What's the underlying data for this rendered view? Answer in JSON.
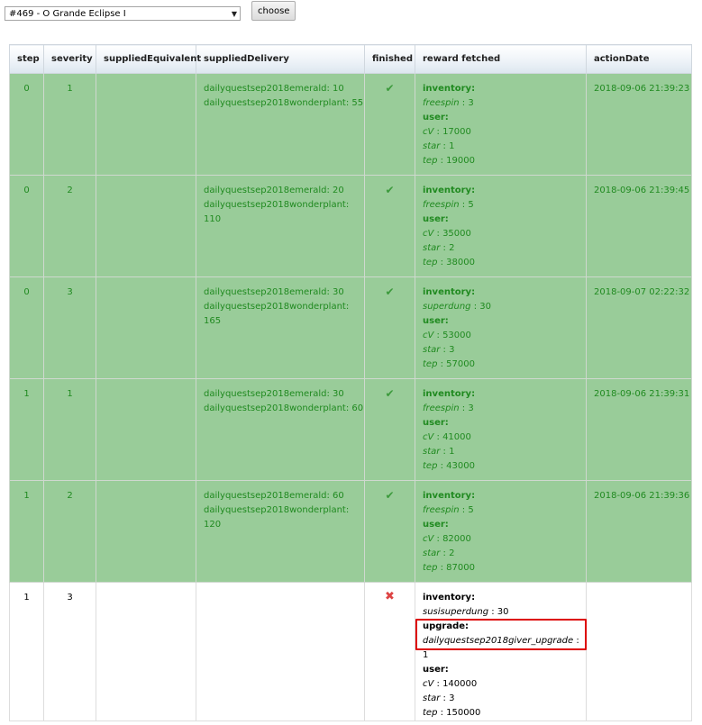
{
  "selector": {
    "selected_value": "#469 - O Grande Eclipse I",
    "arrow_icon": "dropdown-arrow-icon"
  },
  "choose_button": {
    "label": "choose"
  },
  "table": {
    "headers": [
      "step",
      "severity",
      "suppliedEquivalent",
      "suppliedDelivery",
      "finished",
      "reward fetched",
      "actionDate"
    ],
    "rows": [
      {
        "step": "0",
        "severity": "1",
        "supplied_equivalent": "",
        "delivery": [
          "dailyquestsep2018emerald: 10",
          "dailyquestsep2018wonderplant: 55"
        ],
        "finished_icon": "check-icon",
        "finished_glyph": "✔",
        "reward": [
          {
            "text": "inventory:",
            "style": "key"
          },
          {
            "text": "freespin",
            "value": " : 3",
            "style": "sub"
          },
          {
            "text": "user:",
            "style": "key"
          },
          {
            "text": "cV",
            "value": " : 17000",
            "style": "sub"
          },
          {
            "text": "star",
            "value": " : 1",
            "style": "sub"
          },
          {
            "text": "tep",
            "value": " : 19000",
            "style": "sub"
          }
        ],
        "date": "2018-09-06 21:39:23"
      },
      {
        "step": "0",
        "severity": "2",
        "supplied_equivalent": "",
        "delivery": [
          "dailyquestsep2018emerald: 20",
          "dailyquestsep2018wonderplant: 110"
        ],
        "finished_icon": "check-icon",
        "finished_glyph": "✔",
        "reward": [
          {
            "text": "inventory:",
            "style": "key"
          },
          {
            "text": "freespin",
            "value": " : 5",
            "style": "sub"
          },
          {
            "text": "user:",
            "style": "key"
          },
          {
            "text": "cV",
            "value": " : 35000",
            "style": "sub"
          },
          {
            "text": "star",
            "value": " : 2",
            "style": "sub"
          },
          {
            "text": "tep",
            "value": " : 38000",
            "style": "sub"
          }
        ],
        "date": "2018-09-06 21:39:45"
      },
      {
        "step": "0",
        "severity": "3",
        "supplied_equivalent": "",
        "delivery": [
          "dailyquestsep2018emerald: 30",
          "dailyquestsep2018wonderplant: 165"
        ],
        "finished_icon": "check-icon",
        "finished_glyph": "✔",
        "reward": [
          {
            "text": "inventory:",
            "style": "key"
          },
          {
            "text": "superdung",
            "value": " : 30",
            "style": "sub"
          },
          {
            "text": "user:",
            "style": "key"
          },
          {
            "text": "cV",
            "value": " : 53000",
            "style": "sub"
          },
          {
            "text": "star",
            "value": " : 3",
            "style": "sub"
          },
          {
            "text": "tep",
            "value": " : 57000",
            "style": "sub"
          }
        ],
        "date": "2018-09-07 02:22:32"
      },
      {
        "step": "1",
        "severity": "1",
        "supplied_equivalent": "",
        "delivery": [
          "dailyquestsep2018emerald: 30",
          "dailyquestsep2018wonderplant: 60"
        ],
        "finished_icon": "check-icon",
        "finished_glyph": "✔",
        "reward": [
          {
            "text": "inventory:",
            "style": "key"
          },
          {
            "text": "freespin",
            "value": " : 3",
            "style": "sub"
          },
          {
            "text": "user:",
            "style": "key"
          },
          {
            "text": "cV",
            "value": " : 41000",
            "style": "sub"
          },
          {
            "text": "star",
            "value": " : 1",
            "style": "sub"
          },
          {
            "text": "tep",
            "value": " : 43000",
            "style": "sub"
          }
        ],
        "date": "2018-09-06 21:39:31"
      },
      {
        "step": "1",
        "severity": "2",
        "supplied_equivalent": "",
        "delivery": [
          "dailyquestsep2018emerald: 60",
          "dailyquestsep2018wonderplant: 120"
        ],
        "finished_icon": "check-icon",
        "finished_glyph": "✔",
        "reward": [
          {
            "text": "inventory:",
            "style": "key"
          },
          {
            "text": "freespin",
            "value": " : 5",
            "style": "sub"
          },
          {
            "text": "user:",
            "style": "key"
          },
          {
            "text": "cV",
            "value": " : 82000",
            "style": "sub"
          },
          {
            "text": "star",
            "value": " : 2",
            "style": "sub"
          },
          {
            "text": "tep",
            "value": " : 87000",
            "style": "sub"
          }
        ],
        "date": "2018-09-06 21:39:36"
      },
      {
        "step": "1",
        "severity": "3",
        "supplied_equivalent": "",
        "delivery": [],
        "finished_icon": "cross-icon",
        "finished_glyph": "✖",
        "reward": [
          {
            "text": "inventory:",
            "style": "key"
          },
          {
            "text": "susisuperdung",
            "value": " : 30",
            "style": "sub"
          },
          {
            "text": "upgrade:",
            "style": "key"
          },
          {
            "text": "dailyquestsep2018giver_upgrade",
            "value": " : 1",
            "style": "sub"
          },
          {
            "text": "user:",
            "style": "key"
          },
          {
            "text": "cV",
            "value": " : 140000",
            "style": "sub"
          },
          {
            "text": "star",
            "value": " : 3",
            "style": "sub"
          },
          {
            "text": "tep",
            "value": " : 150000",
            "style": "sub"
          }
        ],
        "date": ""
      }
    ],
    "row_status": [
      "done",
      "done",
      "done",
      "done",
      "done",
      "notdone"
    ]
  },
  "colors": {
    "done_row_bg": "#99cc99",
    "done_row_text": "#208a20",
    "highlight_border": "#dd0000"
  }
}
